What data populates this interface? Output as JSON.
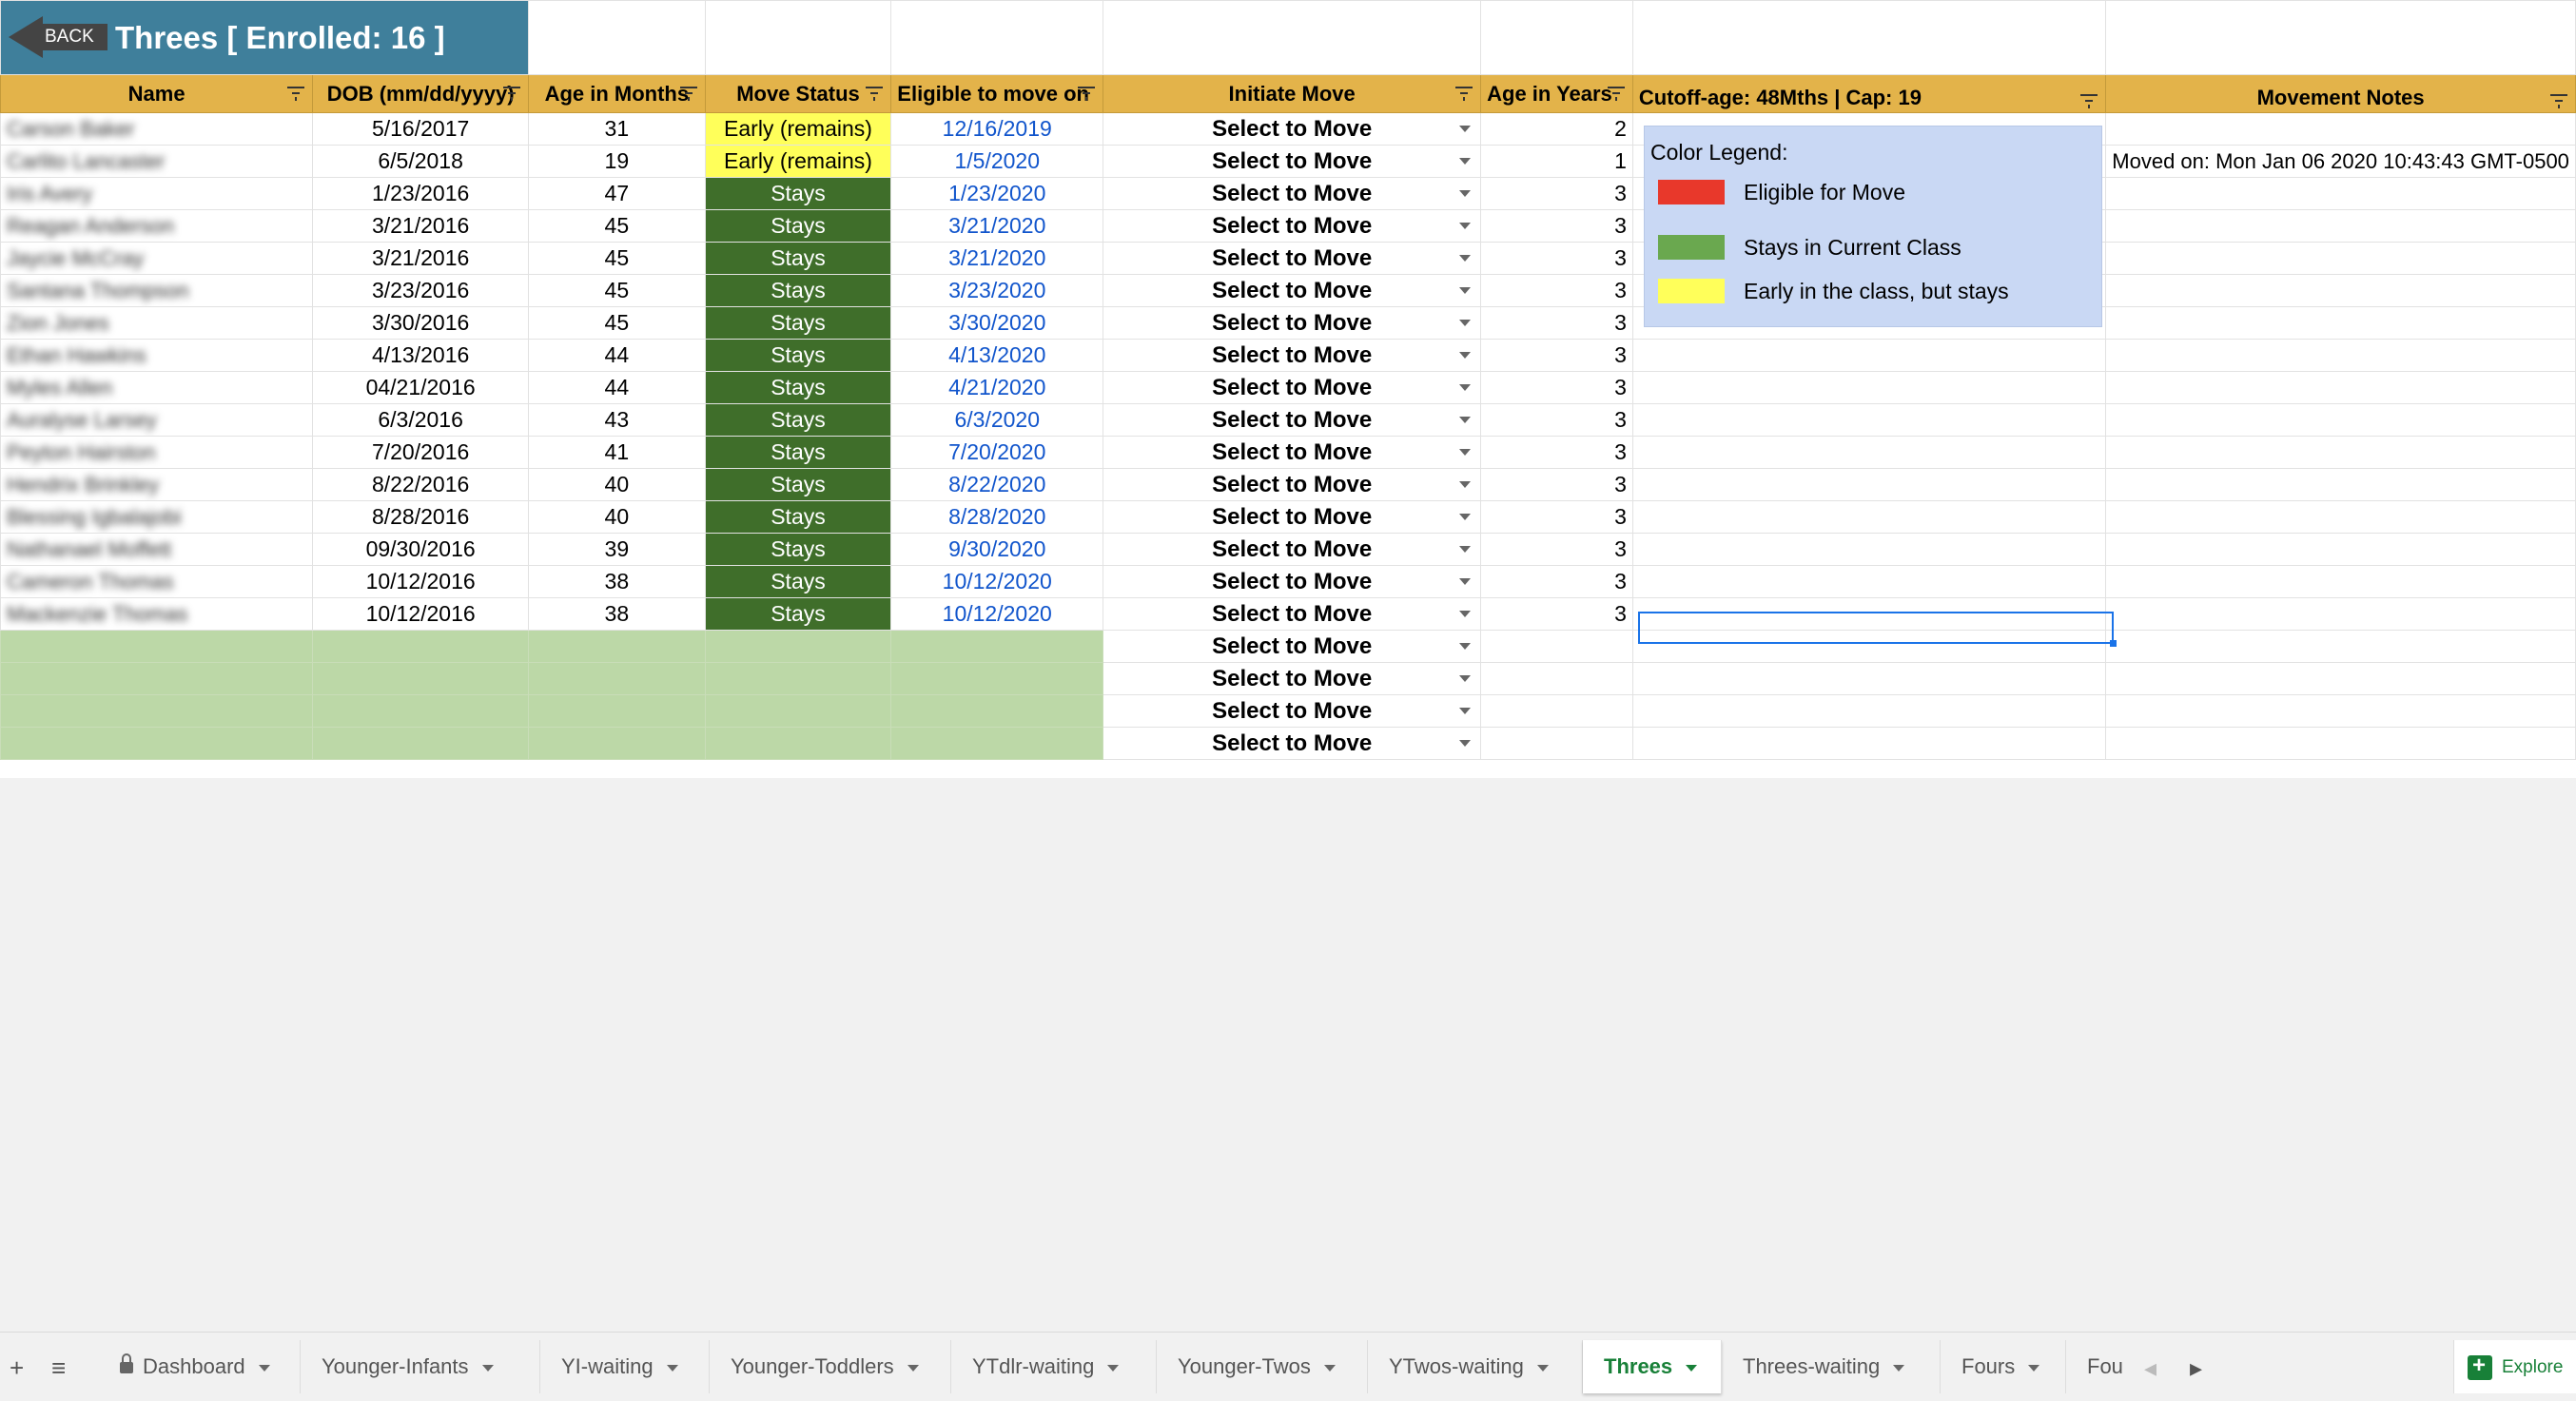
{
  "header": {
    "back_label": "BACK",
    "title": "Threes [ Enrolled: 16 ]"
  },
  "columns": [
    "Name",
    "DOB (mm/dd/yyyy)",
    "Age in Months",
    "Move Status",
    "Eligible to move on",
    "Initiate Move",
    "Age in Years",
    "Cutoff-age:  48Mths | Cap: 19",
    "Movement Notes"
  ],
  "rows": [
    {
      "name": "Carson Baker",
      "dob": "5/16/2017",
      "months": "31",
      "status": "Early (remains)",
      "eligible": "12/16/2019",
      "move": "Select to Move",
      "years": "2",
      "note": ""
    },
    {
      "name": "Carlito Lancaster",
      "dob": "6/5/2018",
      "months": "19",
      "status": "Early (remains)",
      "eligible": "1/5/2020",
      "move": "Select to Move",
      "years": "1",
      "note": "Moved on: Mon Jan 06 2020 10:43:43 GMT-0500"
    },
    {
      "name": "Iris Avery",
      "dob": "1/23/2016",
      "months": "47",
      "status": "Stays",
      "eligible": "1/23/2020",
      "move": "Select to Move",
      "years": "3",
      "note": ""
    },
    {
      "name": "Reagan Anderson",
      "dob": "3/21/2016",
      "months": "45",
      "status": "Stays",
      "eligible": "3/21/2020",
      "move": "Select to Move",
      "years": "3",
      "note": ""
    },
    {
      "name": "Jaycie McCray",
      "dob": "3/21/2016",
      "months": "45",
      "status": "Stays",
      "eligible": "3/21/2020",
      "move": "Select to Move",
      "years": "3",
      "note": ""
    },
    {
      "name": "Santana Thompson",
      "dob": "3/23/2016",
      "months": "45",
      "status": "Stays",
      "eligible": "3/23/2020",
      "move": "Select to Move",
      "years": "3",
      "note": ""
    },
    {
      "name": "Zion Jones",
      "dob": "3/30/2016",
      "months": "45",
      "status": "Stays",
      "eligible": "3/30/2020",
      "move": "Select to Move",
      "years": "3",
      "note": ""
    },
    {
      "name": "Ethan Hawkins",
      "dob": "4/13/2016",
      "months": "44",
      "status": "Stays",
      "eligible": "4/13/2020",
      "move": "Select to Move",
      "years": "3",
      "note": ""
    },
    {
      "name": "Myles Allen",
      "dob": "04/21/2016",
      "months": "44",
      "status": "Stays",
      "eligible": "4/21/2020",
      "move": "Select to Move",
      "years": "3",
      "note": ""
    },
    {
      "name": "Auralyse Larsey",
      "dob": "6/3/2016",
      "months": "43",
      "status": "Stays",
      "eligible": "6/3/2020",
      "move": "Select to Move",
      "years": "3",
      "note": ""
    },
    {
      "name": "Peyton Hairston",
      "dob": "7/20/2016",
      "months": "41",
      "status": "Stays",
      "eligible": "7/20/2020",
      "move": "Select to Move",
      "years": "3",
      "note": ""
    },
    {
      "name": "Hendrix Brinkley",
      "dob": "8/22/2016",
      "months": "40",
      "status": "Stays",
      "eligible": "8/22/2020",
      "move": "Select to Move",
      "years": "3",
      "note": ""
    },
    {
      "name": "Blessing Igbalajobi",
      "dob": "8/28/2016",
      "months": "40",
      "status": "Stays",
      "eligible": "8/28/2020",
      "move": "Select to Move",
      "years": "3",
      "note": ""
    },
    {
      "name": "Nathanael Moffett",
      "dob": "09/30/2016",
      "months": "39",
      "status": "Stays",
      "eligible": "9/30/2020",
      "move": "Select to Move",
      "years": "3",
      "note": ""
    },
    {
      "name": "Cameron Thomas",
      "dob": "10/12/2016",
      "months": "38",
      "status": "Stays",
      "eligible": "10/12/2020",
      "move": "Select to Move",
      "years": "3",
      "note": ""
    },
    {
      "name": "Mackenzie Thomas",
      "dob": "10/12/2016",
      "months": "38",
      "status": "Stays",
      "eligible": "10/12/2020",
      "move": "Select to Move",
      "years": "3",
      "note": ""
    }
  ],
  "empty_rows": [
    {
      "move": "Select to Move"
    },
    {
      "move": "Select to Move"
    },
    {
      "move": "Select to Move"
    },
    {
      "move": "Select to Move"
    }
  ],
  "legend": {
    "title": "Color Legend:",
    "items": [
      {
        "label": "Eligible for Move",
        "color": "#e8382b"
      },
      {
        "label": "Stays in Current Class",
        "color": "#6aa84f"
      },
      {
        "label": "Early in the class, but stays",
        "color": "#ffff5a"
      }
    ]
  },
  "tabs": [
    {
      "label": "Dashboard",
      "locked": true
    },
    {
      "label": "Younger-Infants"
    },
    {
      "label": "YI-waiting"
    },
    {
      "label": "Younger-Toddlers"
    },
    {
      "label": "YTdlr-waiting"
    },
    {
      "label": "Younger-Twos"
    },
    {
      "label": "YTwos-waiting"
    },
    {
      "label": "Threes",
      "active": true
    },
    {
      "label": "Threes-waiting"
    },
    {
      "label": "Fours"
    },
    {
      "label": "Fou"
    }
  ],
  "explore_label": "Explore",
  "colors": {
    "header": "#e3b34a",
    "title_bg": "#3f7f9b",
    "stays": "#3f6e2a",
    "early": "#ffff5a",
    "empty_green": "#bcd8a7",
    "link": "#1155cc",
    "active_tab": "#188038"
  }
}
